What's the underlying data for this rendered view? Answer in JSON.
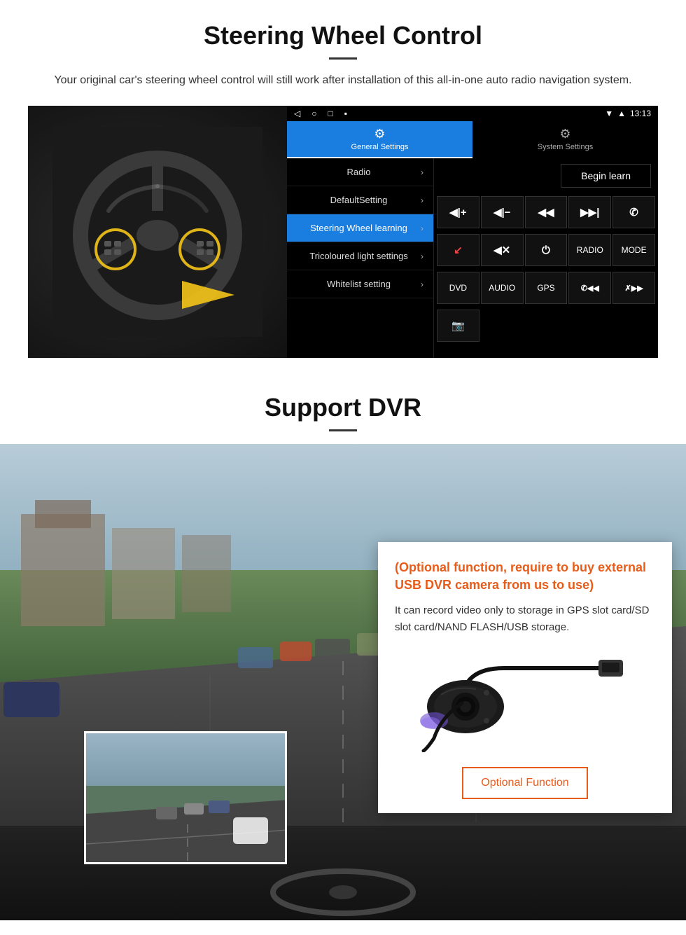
{
  "steering": {
    "title": "Steering Wheel Control",
    "description": "Your original car's steering wheel control will still work after installation of this all-in-one auto radio navigation system.",
    "statusbar": {
      "time": "13:13",
      "nav_back": "◁",
      "nav_home": "○",
      "nav_square": "□",
      "nav_dot": "▪"
    },
    "tabs": [
      {
        "id": "general",
        "icon": "⚙",
        "label": "General Settings",
        "active": true
      },
      {
        "id": "system",
        "icon": "⚙",
        "label": "System Settings",
        "active": false
      }
    ],
    "menu": [
      {
        "id": "radio",
        "label": "Radio",
        "active": false
      },
      {
        "id": "default",
        "label": "DefaultSetting",
        "active": false
      },
      {
        "id": "steering",
        "label": "Steering Wheel learning",
        "active": true
      },
      {
        "id": "tricoloured",
        "label": "Tricoloured light settings",
        "active": false
      },
      {
        "id": "whitelist",
        "label": "Whitelist setting",
        "active": false
      }
    ],
    "begin_learn": "Begin learn",
    "controls": [
      {
        "id": "vol_up",
        "label": "▐◀+",
        "row": 1
      },
      {
        "id": "vol_down",
        "label": "▐◀−",
        "row": 1
      },
      {
        "id": "prev_track",
        "label": "◀◀",
        "row": 1
      },
      {
        "id": "next_track",
        "label": "▶▶",
        "row": 1
      },
      {
        "id": "phone",
        "label": "✆",
        "row": 1
      },
      {
        "id": "hang_up",
        "label": "↙",
        "row": 2
      },
      {
        "id": "mute",
        "label": "◀✕",
        "row": 2
      },
      {
        "id": "power",
        "label": "⏻",
        "row": 2
      },
      {
        "id": "radio_btn",
        "label": "RADIO",
        "row": 2
      },
      {
        "id": "mode",
        "label": "MODE",
        "row": 2
      },
      {
        "id": "dvd",
        "label": "DVD",
        "row": 3
      },
      {
        "id": "audio",
        "label": "AUDIO",
        "row": 3
      },
      {
        "id": "gps",
        "label": "GPS",
        "row": 3
      },
      {
        "id": "phone_prev",
        "label": "✆◀◀",
        "row": 3
      },
      {
        "id": "phone_next",
        "label": "✗▶▶",
        "row": 3
      },
      {
        "id": "camera",
        "label": "📷",
        "row": 4
      }
    ]
  },
  "dvr": {
    "title": "Support DVR",
    "optional_heading": "(Optional function, require to buy external USB DVR camera from us to use)",
    "description": "It can record video only to storage in GPS slot card/SD slot card/NAND FLASH/USB storage.",
    "optional_button": "Optional Function"
  }
}
